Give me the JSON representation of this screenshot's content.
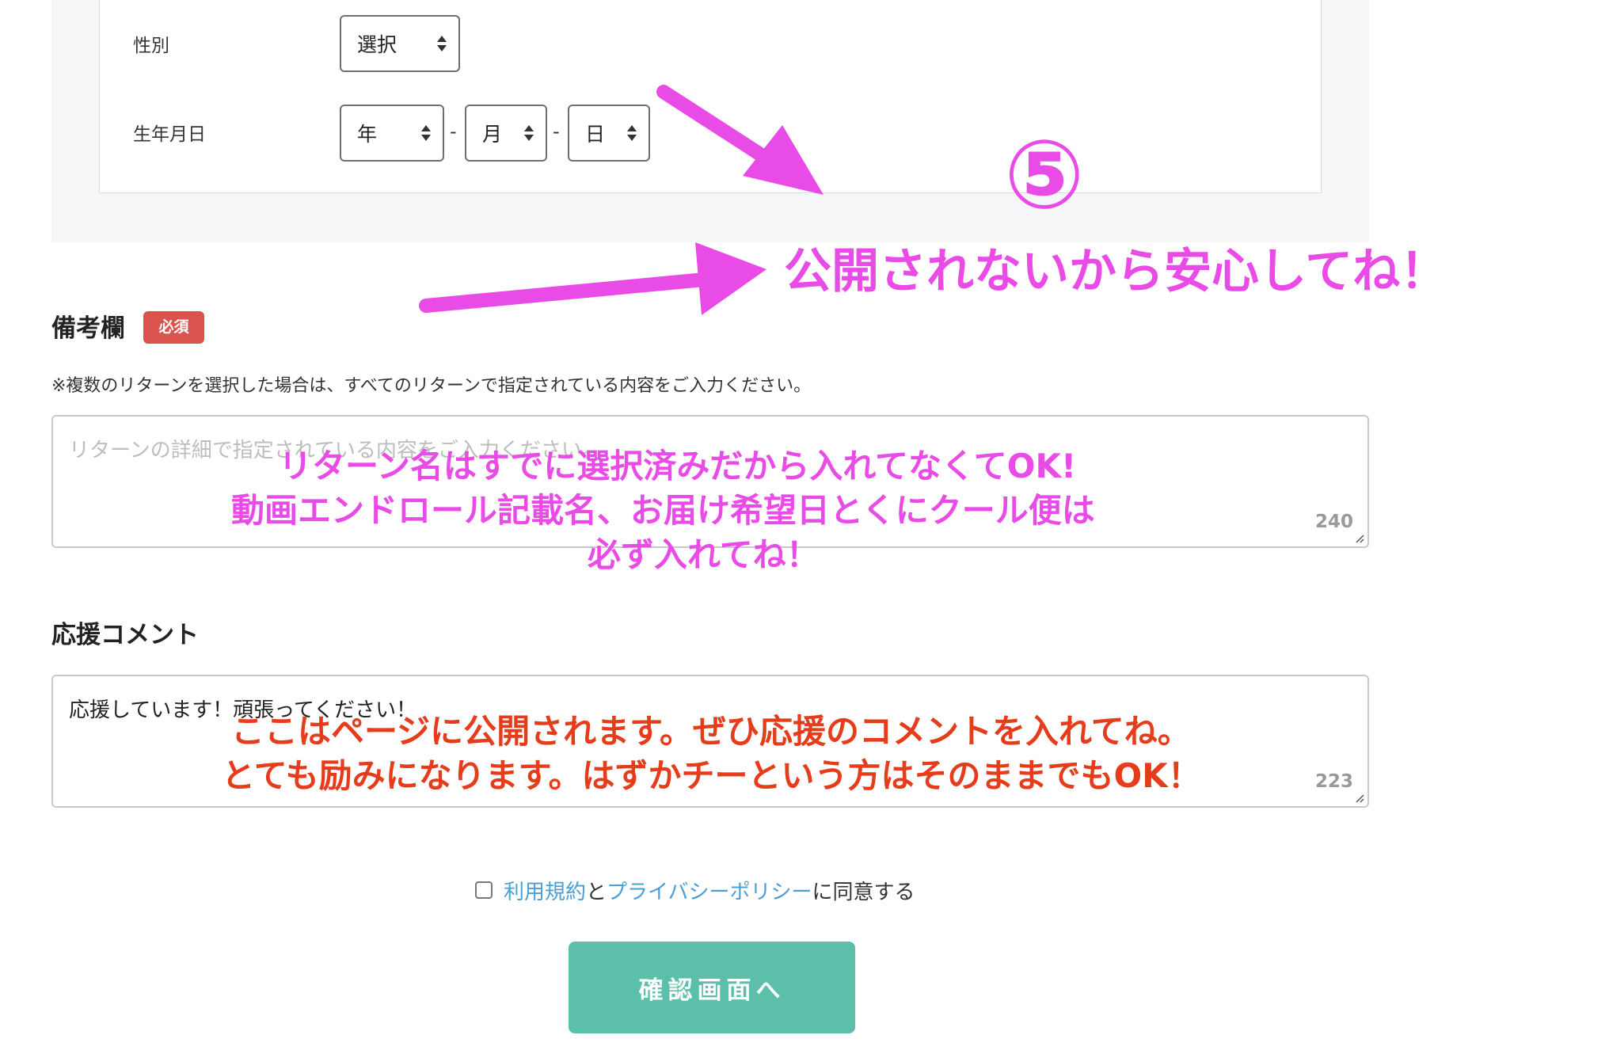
{
  "form": {
    "gender": {
      "label": "性別",
      "value": "選択"
    },
    "birthday": {
      "label": "生年月日",
      "year": "年",
      "month": "月",
      "day": "日",
      "separator": "-"
    }
  },
  "remarks": {
    "title": "備考欄",
    "badge": "必須",
    "note": "※複数のリターンを選択した場合は、すべてのリターンで指定されている内容をご入力ください。",
    "placeholder": "リターンの詳細で指定されている内容をご入力ください。",
    "counter": "240"
  },
  "support": {
    "title": "応援コメント",
    "value": "応援しています！頑張ってください！",
    "counter": "223"
  },
  "agreement": {
    "terms_link": "利用規約",
    "and": "と",
    "privacy_link": "プライバシーポリシー",
    "suffix": "に同意する"
  },
  "confirm_button": "確認画面へ",
  "annotations": {
    "step_number": "⑤",
    "private_note": "公開されないから安心してね！",
    "remarks_line1": "リターン名はすでに選択済みだから入れてなくてOK!",
    "remarks_line2": "動画エンドロール記載名、お届け希望日とくにクール便は",
    "remarks_line3": "必ず入れてね！",
    "comment_line1": "ここはページに公開されます。ぜひ応援のコメントを入れてね。",
    "comment_line2": "とても励みになります。はずかチーという方はそのままでもOK！"
  },
  "colors": {
    "annotation_pink": "#e94be7",
    "annotation_red": "#e53d1c",
    "badge": "#d9534f",
    "button": "#5bbfa9",
    "link": "#4a9fd4"
  }
}
